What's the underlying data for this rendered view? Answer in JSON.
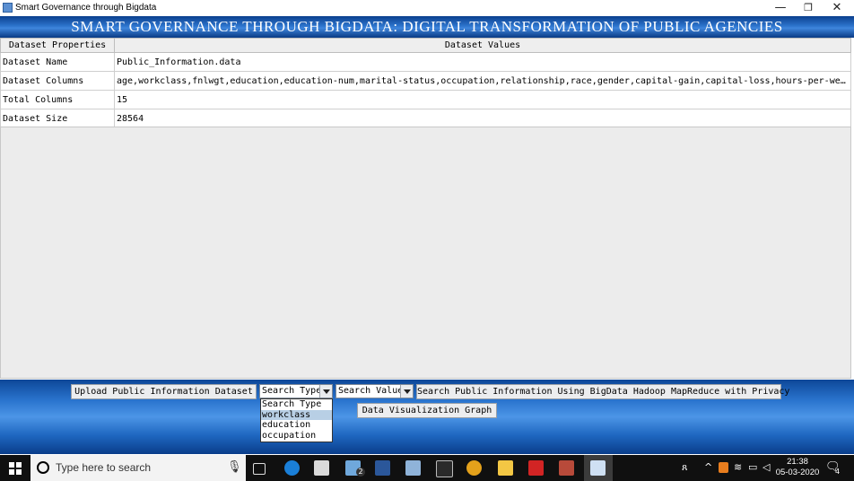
{
  "window": {
    "title": "Smart Governance through Bigdata",
    "min": "—",
    "max": "❐",
    "close": "✕"
  },
  "banner": "SMART GOVERNANCE THROUGH BIGDATA: DIGITAL TRANSFORMATION OF PUBLIC AGENCIES",
  "table": {
    "headers": [
      "Dataset Properties",
      "Dataset Values"
    ],
    "rows": [
      {
        "key": "Dataset Name",
        "value": "Public_Information.data"
      },
      {
        "key": "Dataset Columns",
        "value": "age,workclass,fnlwgt,education,education-num,marital-status,occupation,relationship,race,gender,capital-gain,capital-loss,hours-per-week,native-..."
      },
      {
        "key": "Total Columns",
        "value": "15"
      },
      {
        "key": "Dataset Size",
        "value": "28564"
      }
    ]
  },
  "controls": {
    "upload_label": "Upload Public Information Dataset",
    "search_type_selected": "Search Type",
    "search_value_selected": "Search Value",
    "search_label": "Search Public Information Using BigData Hadoop MapReduce with Privacy",
    "graph_label": "Data Visualization Graph",
    "dropdown_options": [
      "Search Type",
      "workclass",
      "education",
      "occupation"
    ],
    "dropdown_selected_index": 1
  },
  "taskbar": {
    "search_placeholder": "Type here to search",
    "mail_badge": "2",
    "time": "21:38",
    "date": "05-03-2020",
    "notification_count": "4"
  }
}
